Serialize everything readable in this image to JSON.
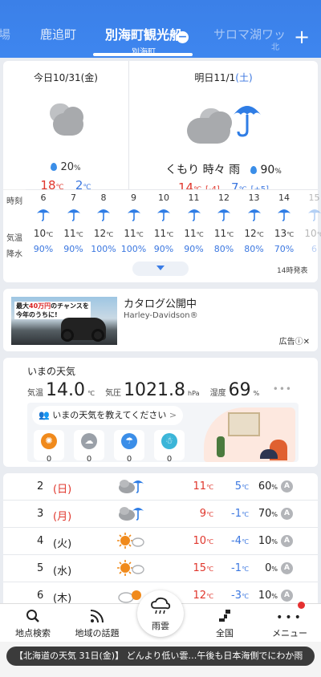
{
  "tabs": {
    "items": [
      "場",
      "鹿追町",
      "サロマ湖ワッ"
    ],
    "active_title": "別海町観光船",
    "active_subtitle": "別海町",
    "partial_sub": "北"
  },
  "today": {
    "title": "今日10/31(金)",
    "weather_icon": "cloudy",
    "precip": "20",
    "precip_unit": "%",
    "high": "18",
    "low": "2",
    "unit": "℃"
  },
  "tomorrow": {
    "title_prefix": "明日11/1",
    "title_day": "(土)",
    "weather_icon": "cloudy-rain",
    "condition": "くもり 時々 雨",
    "precip": "90",
    "precip_unit": "%",
    "high": "14",
    "high_diff": "[-4]",
    "low": "7",
    "low_diff": "[+5]",
    "unit": "℃"
  },
  "hourly": {
    "labels": {
      "time": "時刻",
      "temp": "気温",
      "precip": "降水"
    },
    "hours": [
      "6",
      "7",
      "8",
      "9",
      "10",
      "11",
      "12",
      "13",
      "14",
      "15"
    ],
    "temps": [
      "10",
      "11",
      "12",
      "11",
      "11",
      "11",
      "11",
      "12",
      "13",
      "10"
    ],
    "precip": [
      "90%",
      "90%",
      "100%",
      "100%",
      "90%",
      "90%",
      "80%",
      "80%",
      "70%",
      "6"
    ],
    "temp_unit": "℃",
    "expand_icon": "chevron-down",
    "announced": "14時発表"
  },
  "ad": {
    "image_line1_pre": "最大",
    "image_line1_em": "40万円",
    "image_line1_post": "のチャンスを",
    "image_line2": "今年のうちに!",
    "title": "カタログ公開中",
    "sponsor": "Harley-Davidson®",
    "tag": "広告ⓘ✕"
  },
  "now": {
    "title": "いまの天気",
    "temp_label": "気温",
    "temp": "14.0",
    "temp_unit": "℃",
    "pressure_label": "気圧",
    "pressure": "1021.8",
    "pressure_unit": "hPa",
    "humidity_label": "湿度",
    "humidity": "69",
    "humidity_unit": "%",
    "more": "•••",
    "share_prompt": "いまの天気を教えてください",
    "share_chevron": ">",
    "reports": [
      {
        "icon": "sun",
        "count": "0",
        "color": "#f08a1c"
      },
      {
        "icon": "cloud",
        "count": "0",
        "color": "#9aa0a8"
      },
      {
        "icon": "umbrella",
        "count": "0",
        "color": "#3b8ee8"
      },
      {
        "icon": "snowman",
        "count": "0",
        "color": "#3bb5d8"
      }
    ]
  },
  "weekly": [
    {
      "date": "2",
      "day": "(日)",
      "day_color": "#e0362c",
      "icon": "cloudy-rain",
      "high": "11",
      "low": "5",
      "precip": "60",
      "rank": "A"
    },
    {
      "date": "3",
      "day": "(月)",
      "day_color": "#e0362c",
      "icon": "cloudy-rain",
      "high": "9",
      "low": "-1",
      "precip": "70",
      "rank": "A"
    },
    {
      "date": "4",
      "day": "(火)",
      "day_color": "#222222",
      "icon": "sun-cloud",
      "high": "10",
      "low": "-4",
      "precip": "10",
      "rank": "A"
    },
    {
      "date": "5",
      "day": "(水)",
      "day_color": "#222222",
      "icon": "sun-cloud",
      "high": "15",
      "low": "-1",
      "precip": "0",
      "rank": "A"
    },
    {
      "date": "6",
      "day": "(木)",
      "day_color": "#222222",
      "icon": "cloud-sun",
      "high": "12",
      "low": "-3",
      "precip": "10",
      "rank": "A"
    }
  ],
  "weekly_units": {
    "temp": "℃",
    "precip": "%"
  },
  "nav": {
    "search": "地点検索",
    "topics": "地域の話題",
    "rain": "雨雲",
    "national": "全国",
    "menu": "メニュー"
  },
  "news": "【北海道の天気 31日(金)】 どんより低い雲…午後も日本海側でにわか雨"
}
